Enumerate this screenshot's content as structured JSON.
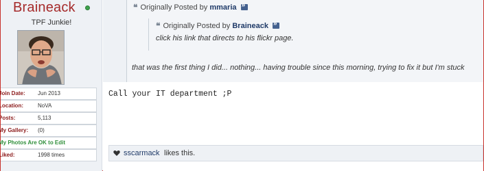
{
  "user": {
    "name": "Braineack",
    "title": "TPF Junkie!",
    "stats": [
      {
        "label": "Join Date:",
        "value": "Jun 2013"
      },
      {
        "label": "Location:",
        "value": "NoVA"
      },
      {
        "label": "Posts:",
        "value": "5,113"
      },
      {
        "label": "My Gallery:",
        "value": "(0)"
      },
      {
        "label": "My Photos Are OK to Edit",
        "value": ""
      },
      {
        "label": "Liked:",
        "value": "1998 times"
      }
    ]
  },
  "quote_outer": {
    "prefix": "Originally Posted by",
    "author": "mmaria",
    "text": "that was the first thing I did... nothing... having trouble since this morning, trying to fix it but I'm stuck"
  },
  "quote_inner": {
    "prefix": "Originally Posted by",
    "author": "Braineack",
    "text": "click his link that directs to his flickr page."
  },
  "post": {
    "body": "Call your IT department ;P"
  },
  "likes": {
    "user": "sscarmack",
    "suffix": "likes this."
  },
  "colors": {
    "username": "#a52a2a",
    "online": "#3fa34d",
    "link": "#1f3a68",
    "stat_label": "#8b1a1a",
    "stat_green": "#2f8f3a",
    "frame_border": "#c8322c"
  },
  "icons": {
    "quote": "quote-icon",
    "goto": "goto-post-icon",
    "like": "heart-icon"
  }
}
